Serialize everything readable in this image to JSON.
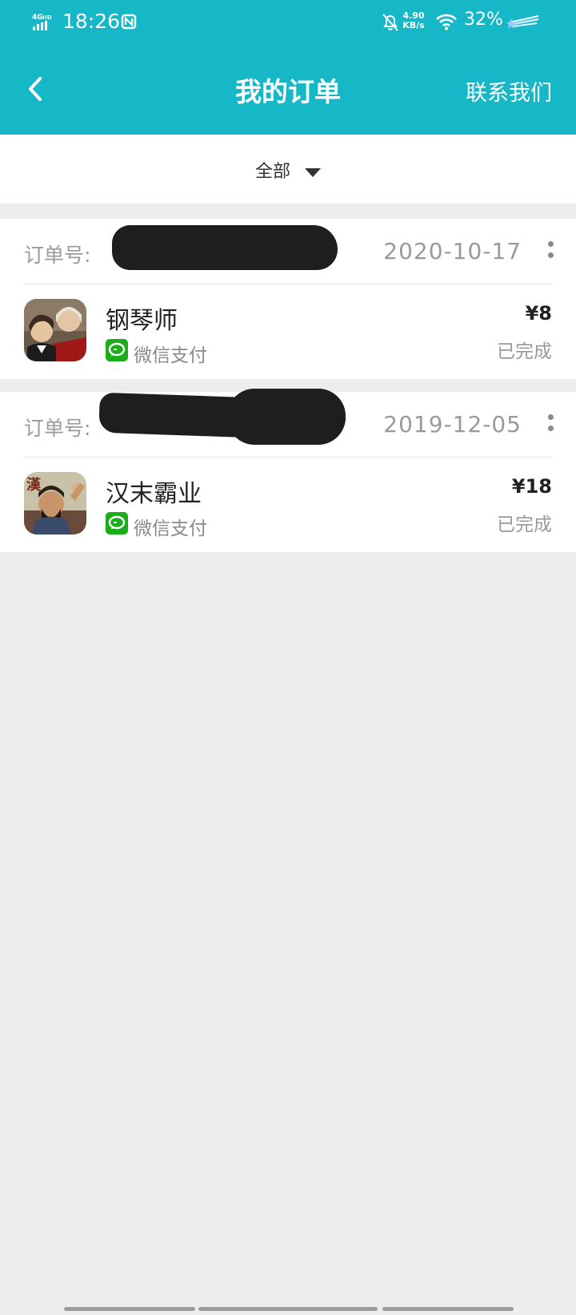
{
  "status_bar": {
    "network": "4GHD",
    "time": "18:26",
    "speed_value": "4.90",
    "speed_unit": "KB/s",
    "battery": "32%"
  },
  "nav": {
    "back_icon": "chevron-left-icon",
    "title": "我的订单",
    "contact": "联系我们"
  },
  "filter": {
    "label": "全部",
    "icon": "caret-down-icon"
  },
  "orders": [
    {
      "order_no_label": "订单号:",
      "date": "2020-10-17",
      "app_name": "钢琴师",
      "payment": "微信支付",
      "price": "¥8",
      "status": "已完成"
    },
    {
      "order_no_label": "订单号:",
      "date": "2019-12-05",
      "app_name": "汉末霸业",
      "payment": "微信支付",
      "price": "¥18",
      "status": "已完成"
    }
  ],
  "colors": {
    "header_bg": "#16b8c8",
    "page_bg": "#ededed",
    "wechat_green": "#1aad19"
  }
}
